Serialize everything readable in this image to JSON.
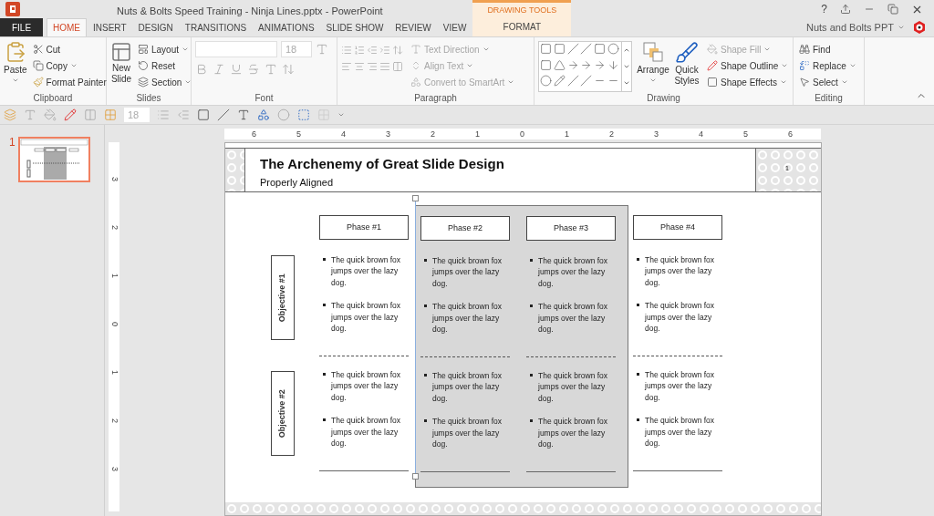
{
  "window": {
    "title": "Nuts & Bolts Speed Training - Ninja Lines.pptx - PowerPoint",
    "help": "?"
  },
  "tabs": [
    {
      "label": "FILE",
      "kind": "file",
      "selected": false
    },
    {
      "label": "HOME",
      "kind": "tab",
      "selected": true
    },
    {
      "label": "INSERT",
      "kind": "tab",
      "selected": false
    },
    {
      "label": "DESIGN",
      "kind": "tab",
      "selected": false
    },
    {
      "label": "TRANSITIONS",
      "kind": "tab",
      "selected": false
    },
    {
      "label": "ANIMATIONS",
      "kind": "tab",
      "selected": false
    },
    {
      "label": "SLIDE SHOW",
      "kind": "tab",
      "selected": false
    },
    {
      "label": "REVIEW",
      "kind": "tab",
      "selected": false
    },
    {
      "label": "VIEW",
      "kind": "tab",
      "selected": false
    },
    {
      "label": "FORMAT",
      "kind": "context",
      "context": "DRAWING TOOLS",
      "selected": false
    }
  ],
  "account": "Nuts and Bolts PPT",
  "ribbon": {
    "clipboard": {
      "label": "Clipboard",
      "paste": "Paste",
      "cut": "Cut",
      "copy": "Copy",
      "format_painter": "Format Painter"
    },
    "slides": {
      "label": "Slides",
      "new_slide": "New Slide",
      "layout": "Layout",
      "reset": "Reset",
      "section": "Section"
    },
    "font": {
      "label": "Font",
      "size": "18",
      "disabled": true
    },
    "paragraph": {
      "label": "Paragraph",
      "text_direction": "Text Direction",
      "align_text": "Align Text",
      "convert": "Convert to SmartArt",
      "disabled": true
    },
    "drawing": {
      "label": "Drawing",
      "arrange": "Arrange",
      "quick_styles": "Quick Styles",
      "shape_fill": {
        "label": "Shape Fill",
        "disabled": true
      },
      "shape_outline": {
        "label": "Shape Outline",
        "disabled": false
      },
      "shape_effects": {
        "label": "Shape Effects",
        "disabled": false
      }
    },
    "editing": {
      "label": "Editing",
      "find": "Find",
      "replace": "Replace",
      "select": "Select"
    }
  },
  "quick_toolbar": {
    "font_size": "18"
  },
  "thumbnails": [
    {
      "number": "1",
      "selected": true
    }
  ],
  "ruler": {
    "horizontal": [
      "6",
      "5",
      "4",
      "3",
      "2",
      "1",
      "0",
      "1",
      "2",
      "3",
      "4",
      "5",
      "6"
    ],
    "vertical": [
      "3",
      "2",
      "1",
      "0",
      "1",
      "2",
      "3"
    ]
  },
  "slide": {
    "title": "The Archenemy of Great Slide Design",
    "subtitle": "Properly Aligned",
    "page_number": "1",
    "objectives": [
      "Objective #1",
      "Objective #2"
    ],
    "columns": [
      {
        "phase": "Phase #1",
        "highlighted": false,
        "rows": [
          [
            "The quick brown fox jumps over the lazy dog.",
            "The quick brown fox jumps over the lazy dog."
          ],
          [
            "The quick brown fox jumps over the lazy dog.",
            "The quick brown fox jumps over the lazy dog."
          ]
        ]
      },
      {
        "phase": "Phase #2",
        "highlighted": true,
        "rows": [
          [
            "The quick brown fox jumps over the lazy dog.",
            "The quick brown fox jumps over the lazy dog."
          ],
          [
            "The quick brown fox jumps over the lazy dog.",
            "The quick brown fox jumps over the lazy dog."
          ]
        ]
      },
      {
        "phase": "Phase #3",
        "highlighted": true,
        "rows": [
          [
            "The quick brown fox jumps over the lazy dog.",
            "The quick brown fox jumps over the lazy dog."
          ],
          [
            "The quick brown fox jumps over the lazy dog.",
            "The quick brown fox jumps over the lazy dog."
          ]
        ]
      },
      {
        "phase": "Phase #4",
        "highlighted": false,
        "rows": [
          [
            "The quick brown fox jumps over the lazy dog.",
            "The quick brown fox jumps over the lazy dog."
          ],
          [
            "The quick brown fox jumps over the lazy dog.",
            "The quick brown fox jumps over the lazy dog."
          ]
        ]
      }
    ]
  }
}
